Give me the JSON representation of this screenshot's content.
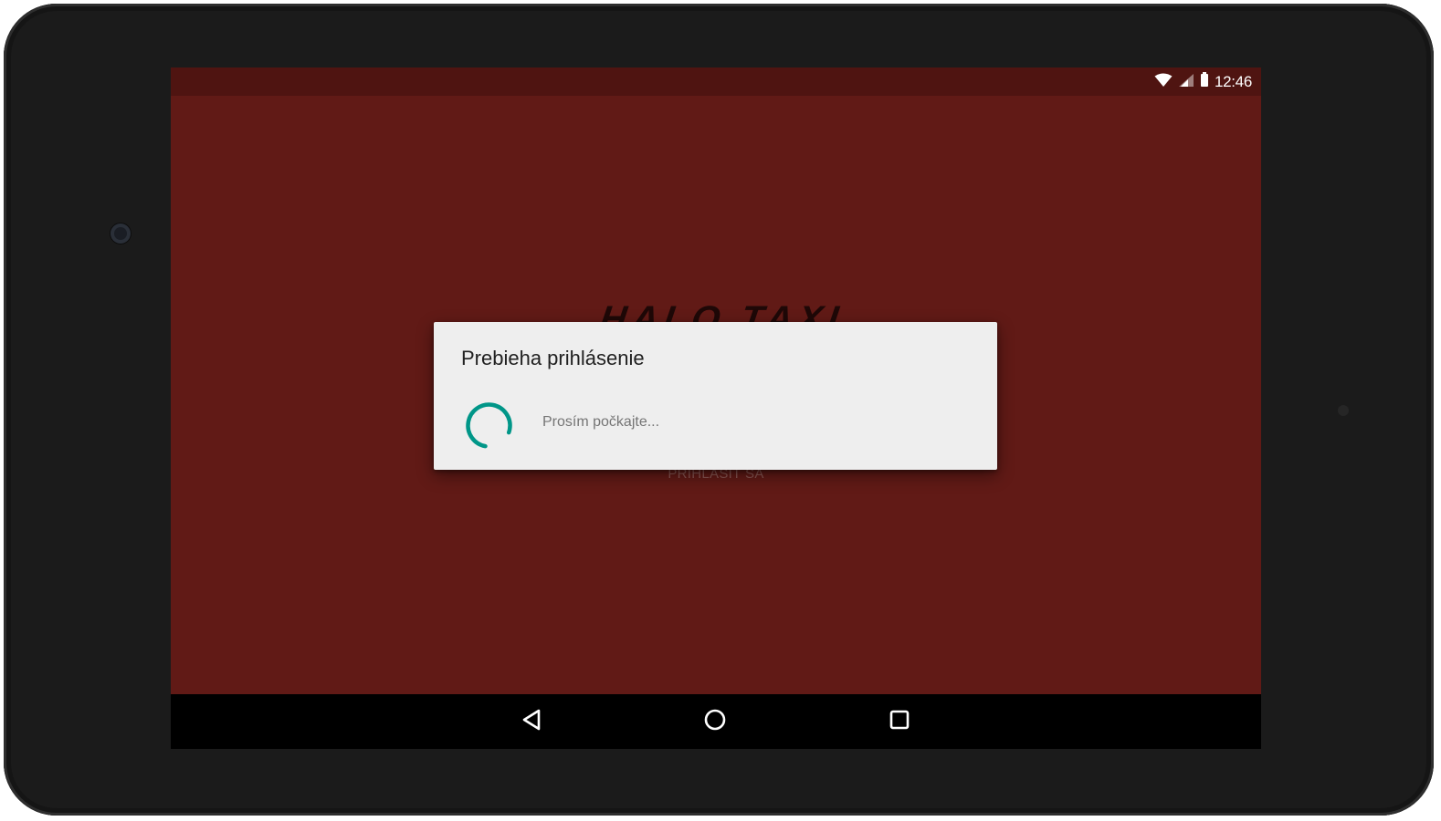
{
  "status_bar": {
    "time": "12:46",
    "icons": [
      "wifi-icon",
      "cell-signal-icon",
      "battery-icon"
    ]
  },
  "app": {
    "logo_text": "HALO TAXI",
    "login_button_label": "PRIHLÁSIŤ SA",
    "background_color": "#611a16"
  },
  "dialog": {
    "title": "Prebieha prihlásenie",
    "message": "Prosím počkajte...",
    "spinner_color": "#009688"
  },
  "nav_bar": {
    "buttons": [
      "back-icon",
      "home-icon",
      "recents-icon"
    ]
  }
}
